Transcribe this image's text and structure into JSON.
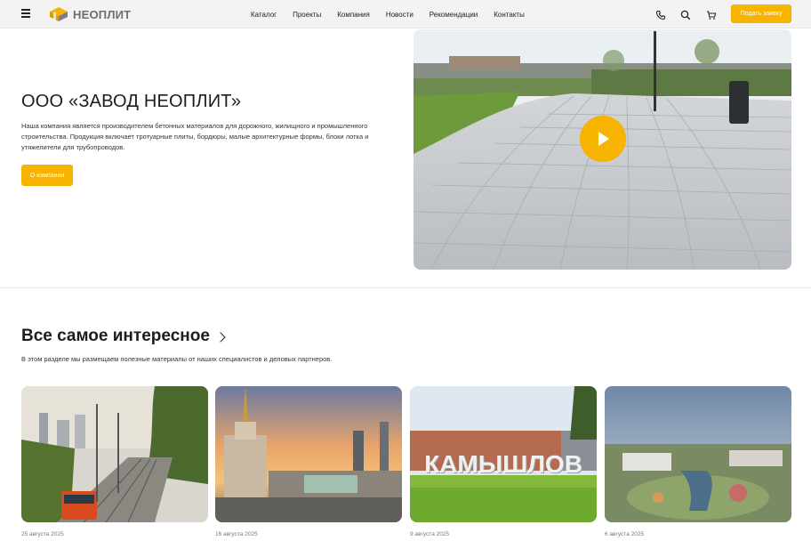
{
  "header": {
    "logo_text": "НЕОПЛИТ",
    "nav": [
      "Каталог",
      "Проекты",
      "Компания",
      "Новости",
      "Рекомендации",
      "Контакты"
    ],
    "cta_label": "Подать заявку",
    "icons": [
      "phone-icon",
      "search-icon",
      "cart-icon"
    ]
  },
  "hero": {
    "title": "ООО «ЗАВОД НЕОПЛИТ»",
    "text": "Наша компания является производителем бетонных материалов для дорожного, жилищного и промышленного строительства. Продукция включает тротуарные плиты, бордюры, малые архитектурные формы, блоки лотка и утяжелители для трубопроводов.",
    "button_label": "О компании"
  },
  "section": {
    "title": "Все самое интересное",
    "subtitle": "В этом разделе мы размещаем полезные материалы от наших специалистов и деловых партнеров."
  },
  "cards": [
    {
      "date": "25 августа 2025"
    },
    {
      "date": "16 августа 2025"
    },
    {
      "date": "9 августа 2025",
      "image_text": "КАМЫШЛОВ"
    },
    {
      "date": "6 августа 2025"
    }
  ],
  "colors": {
    "accent": "#f6b300",
    "header_bg": "#f3f3f4"
  }
}
